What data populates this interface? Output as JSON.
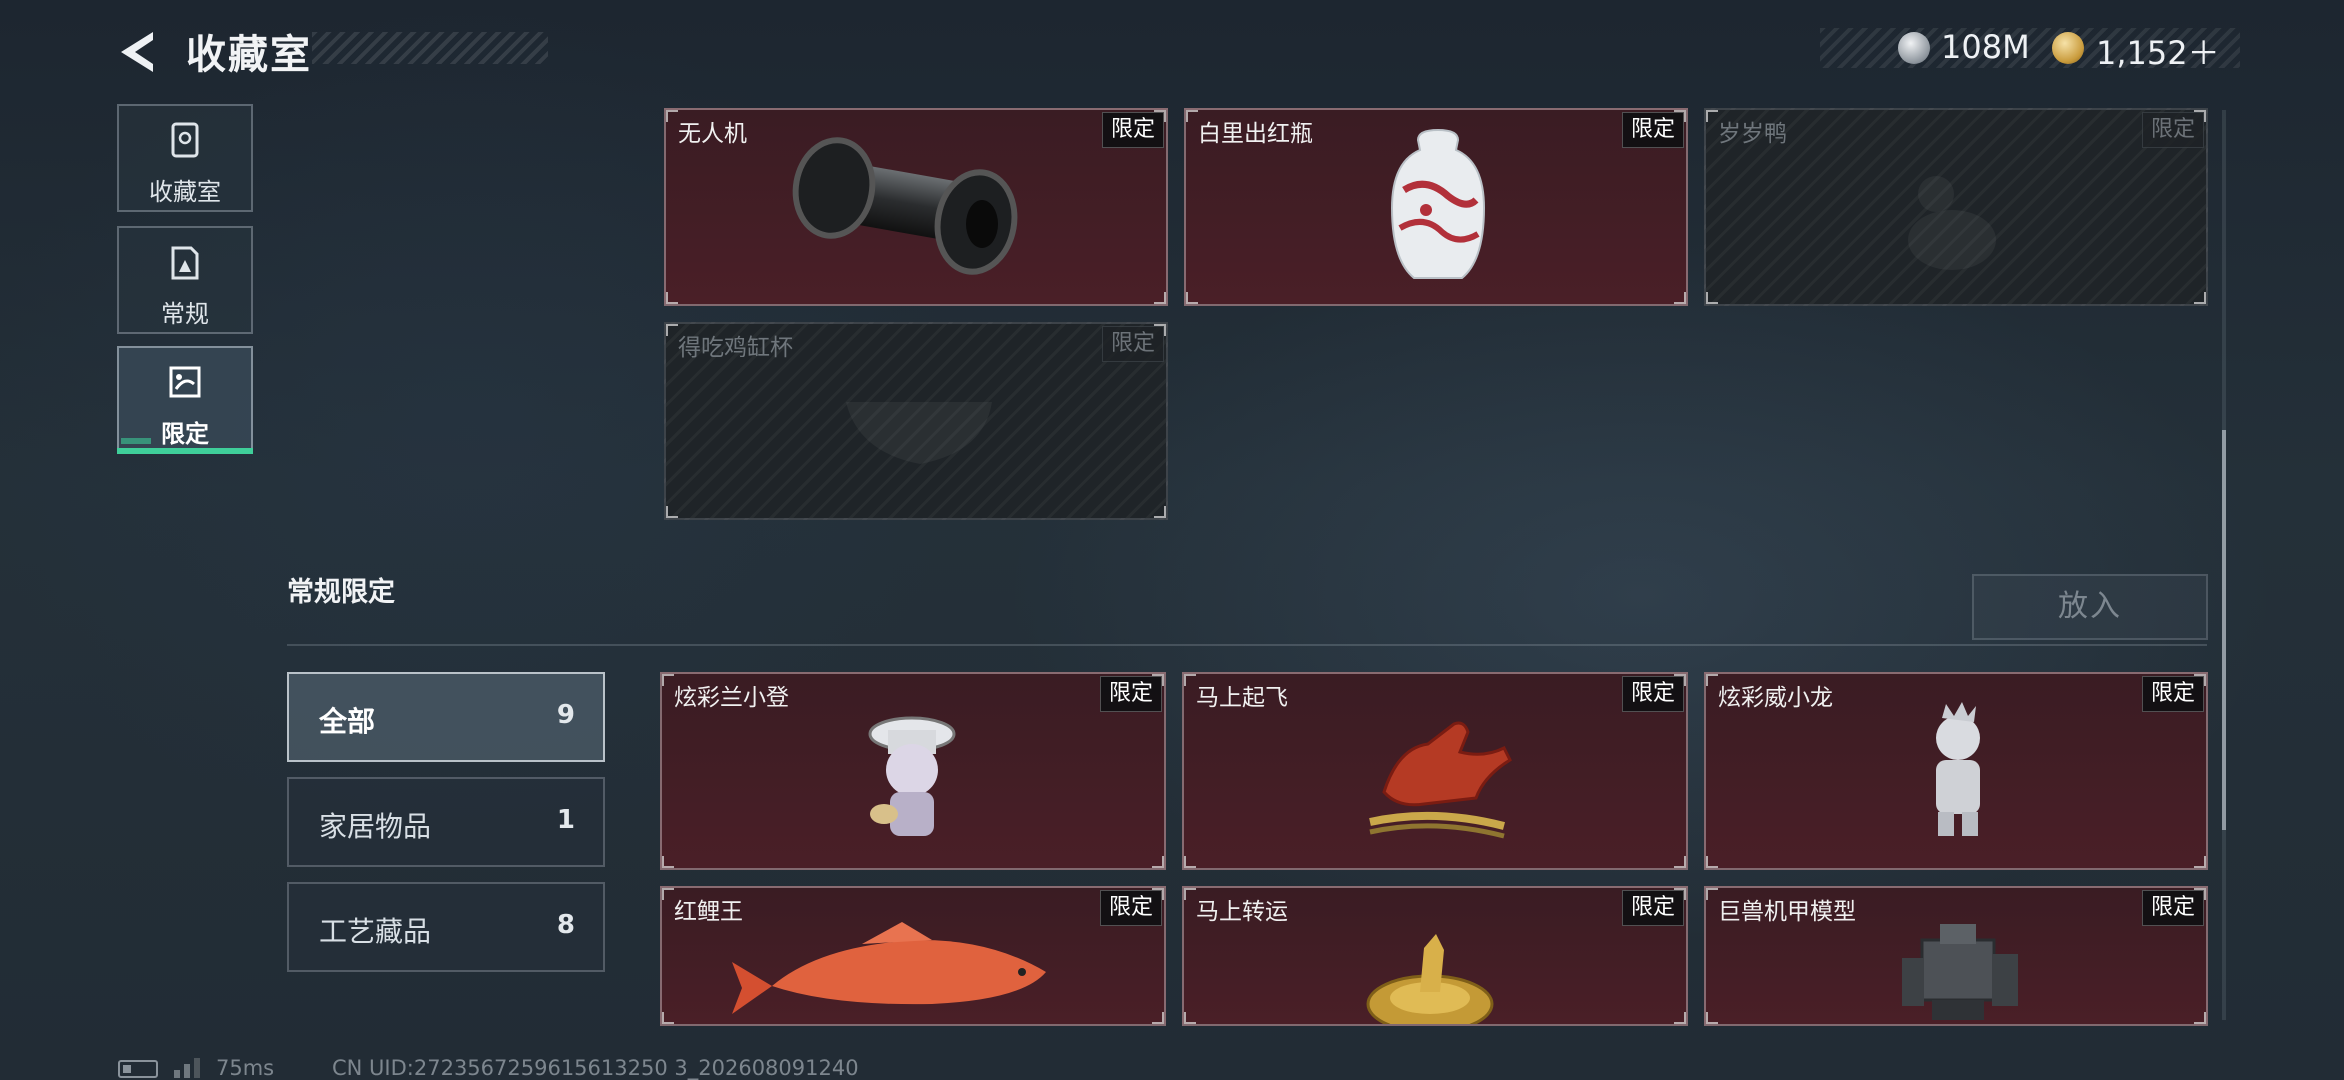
{
  "header": {
    "title": "收藏室",
    "currency1_value": "108M",
    "currency2_value": "1,152＋"
  },
  "nav": {
    "items": [
      {
        "label": "收藏室",
        "icon": "collection-room-icon"
      },
      {
        "label": "常规",
        "icon": "regular-icon"
      },
      {
        "label": "限定",
        "icon": "limited-icon"
      }
    ],
    "active_index": 2
  },
  "top_grid": [
    {
      "name": "无人机",
      "tag": "限定",
      "owned": true,
      "icon": "drone-icon"
    },
    {
      "name": "白里出红瓶",
      "tag": "限定",
      "owned": true,
      "icon": "vase-icon"
    },
    {
      "name": "岁岁鸭",
      "tag": "限定",
      "owned": false,
      "icon": "duck-icon"
    },
    {
      "name": "得吃鸡缸杯",
      "tag": "限定",
      "owned": false,
      "icon": "cup-icon"
    }
  ],
  "section": {
    "title": "常规限定",
    "put_button": "放入"
  },
  "filters": [
    {
      "label": "全部",
      "count": "9",
      "active": true
    },
    {
      "label": "家居物品",
      "count": "1",
      "active": false
    },
    {
      "label": "工艺藏品",
      "count": "8",
      "active": false
    }
  ],
  "bottom_grid": [
    {
      "name": "炫彩兰小登",
      "tag": "限定",
      "owned": true,
      "icon": "figurine-icon"
    },
    {
      "name": "马上起飞",
      "tag": "限定",
      "owned": true,
      "icon": "horse-icon"
    },
    {
      "name": "炫彩威小龙",
      "tag": "限定",
      "owned": true,
      "icon": "dragon-figurine-icon"
    },
    {
      "name": "红鲤王",
      "tag": "限定",
      "owned": true,
      "icon": "carp-icon"
    },
    {
      "name": "马上转运",
      "tag": "限定",
      "owned": true,
      "icon": "golden-compass-icon"
    },
    {
      "name": "巨兽机甲模型",
      "tag": "限定",
      "owned": true,
      "icon": "mech-model-icon"
    }
  ],
  "status": {
    "ping": "75ms",
    "uid": "CN UID:2723567259615613250 3_202608091240"
  },
  "colors": {
    "owned_card_bg": "#4a1f27",
    "accent_green": "#3fcf9a",
    "gold": "#c99b3c"
  }
}
